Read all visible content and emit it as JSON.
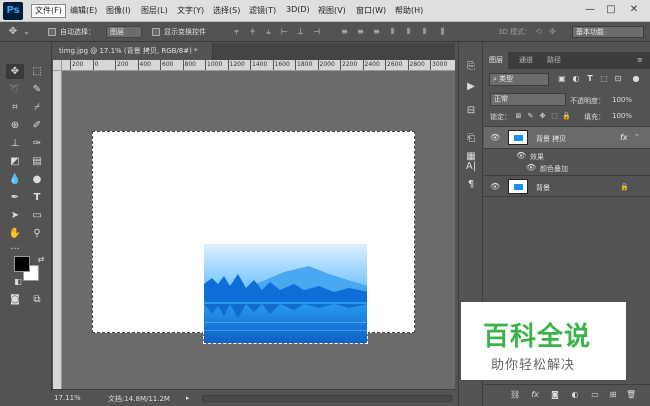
{
  "menubar": {
    "logo": "Ps",
    "items": [
      "文件(F)",
      "编辑(E)",
      "图像(I)",
      "图层(L)",
      "文字(Y)",
      "选择(S)",
      "滤镜(T)",
      "3D(D)",
      "视图(V)",
      "窗口(W)",
      "帮助(H)"
    ],
    "active_index": 0,
    "window_controls": [
      "—",
      "□",
      "✕"
    ]
  },
  "optionsbar": {
    "auto_select_label": "自动选择：",
    "auto_select_value": "图层",
    "show_transform_label": "显示变换控件",
    "mode_3d_label": "3D 模式：",
    "workspace": "基本功能"
  },
  "document": {
    "tab_title": "timg.jpg @ 17.1% (背景 拷贝, RGB/8#) *",
    "ruler_ticks": [
      "200",
      "0",
      "200",
      "400",
      "600",
      "800",
      "1000",
      "1200",
      "1400",
      "1600",
      "1800",
      "2000",
      "2200",
      "2400",
      "2600",
      "2800",
      "3000"
    ]
  },
  "statusbar": {
    "zoom": "17.11%",
    "doc_info": "文档:14.8M/11.2M"
  },
  "layers_panel": {
    "tabs": [
      "图层",
      "通道",
      "路径"
    ],
    "active_tab": 0,
    "filter_kind": "类型",
    "blend_mode": "正常",
    "opacity_label": "不透明度：",
    "opacity_value": "100%",
    "lock_label": "锁定：",
    "fill_label": "填充：",
    "fill_value": "100%",
    "layers": [
      {
        "name": "背景 拷贝",
        "selected": true,
        "fx": "fx"
      },
      {
        "name": "背景",
        "selected": false
      }
    ],
    "effects_label": "效果",
    "effect_item": "颜色叠加"
  },
  "watermark": {
    "title": "百科全说",
    "subtitle": "助你轻松解决"
  },
  "colors": {
    "accent_blue": "#1a8ff0",
    "watermark_green": "#3cb34a"
  }
}
